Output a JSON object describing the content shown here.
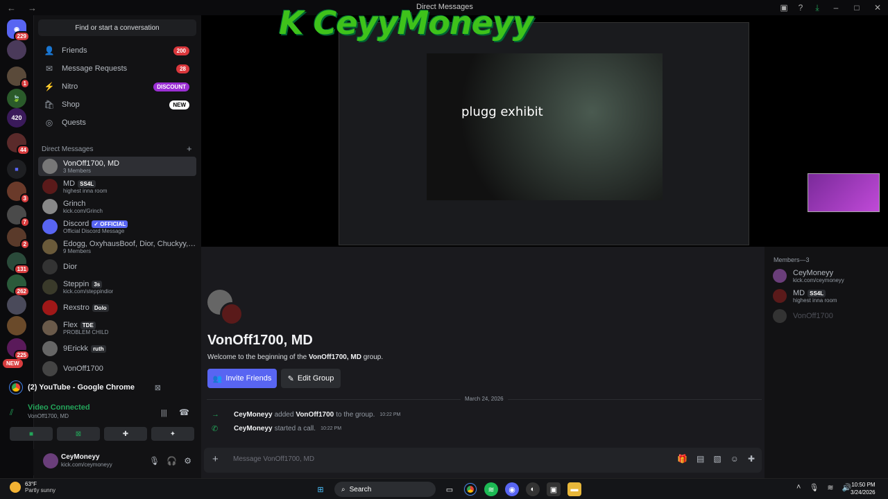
{
  "window": {
    "title": "Direct Messages"
  },
  "rail": {
    "badges": [
      "229",
      "1",
      "44",
      "3",
      "7",
      "2",
      "131",
      "262",
      "225"
    ],
    "new_label": "NEW",
    "server_420": "420"
  },
  "search": {
    "label": "Find or start a conversation"
  },
  "nav": [
    {
      "label": "Friends",
      "badge": "200"
    },
    {
      "label": "Message Requests",
      "badge": "28"
    },
    {
      "label": "Nitro",
      "badge": "DISCOUNT"
    },
    {
      "label": "Shop",
      "badge": "NEW"
    },
    {
      "label": "Quests",
      "badge": ""
    }
  ],
  "dm_header": "Direct Messages",
  "dms": [
    {
      "name": "VonOff1700, MD",
      "sub": "3 Members",
      "tag": ""
    },
    {
      "name": "MD",
      "sub": "highest inna room",
      "tag": "SS4L"
    },
    {
      "name": "Grinch",
      "sub": "kick.com/Grinch",
      "tag": ""
    },
    {
      "name": "Discord",
      "sub": "Official Discord Message",
      "tag": "✓ OFFICIAL"
    },
    {
      "name": "Edogg, OxyhausBoof, Dior, Chuckyy, CH...",
      "sub": "9 Members",
      "tag": ""
    },
    {
      "name": "Dior",
      "sub": "",
      "tag": ""
    },
    {
      "name": "Steppin",
      "sub": "kick.com/steppindior",
      "tag": "3s"
    },
    {
      "name": "Rexstro",
      "sub": "",
      "tag": "Dolo"
    },
    {
      "name": "Flex",
      "sub": "PROBLEM CHILD",
      "tag": "TDE"
    },
    {
      "name": "9Erickk",
      "sub": "",
      "tag": "ruth"
    },
    {
      "name": "VonOff1700",
      "sub": "",
      "tag": ""
    }
  ],
  "voice": {
    "app": "(2) YouTube - Google Chrome",
    "status": "Video Connected",
    "channel": "VonOff1700, MD"
  },
  "user": {
    "name": "CeyMoneyy",
    "status": "kick.com/ceymoneyy"
  },
  "stream": {
    "overlay_text": "plugg exhibit",
    "banner": "K CeyyMoneyy"
  },
  "chat": {
    "group_title": "VonOff1700, MD",
    "welcome_prefix": "Welcome to the beginning of the",
    "welcome_name": "VonOff1700, MD",
    "welcome_suffix": "group.",
    "invite_label": "Invite Friends",
    "edit_label": "Edit Group",
    "date": "March 24, 2026",
    "events": [
      {
        "who": "CeyMoneyy",
        "mid": "added",
        "target": "VonOff1700",
        "tail": "to the group.",
        "time": "10:22 PM"
      },
      {
        "who": "CeyMoneyy",
        "mid": "started a call.",
        "target": "",
        "tail": "",
        "time": "10:22 PM"
      }
    ],
    "placeholder": "Message VonOff1700, MD"
  },
  "members": {
    "header": "Members—3",
    "list": [
      {
        "name": "CeyMoneyy",
        "sub": "kick.com/ceymoneyy",
        "tag": ""
      },
      {
        "name": "MD",
        "sub": "highest inna room",
        "tag": "SS4L"
      },
      {
        "name": "VonOff1700",
        "sub": "",
        "tag": ""
      }
    ]
  },
  "taskbar": {
    "temp": "63°F",
    "weather": "Partly sunny",
    "search": "Search",
    "time": "10:50 PM",
    "date": "3/24/2026"
  },
  "colors": {
    "accent": "#5865f2",
    "online": "#23a55a",
    "badge_red": "#da373c"
  }
}
